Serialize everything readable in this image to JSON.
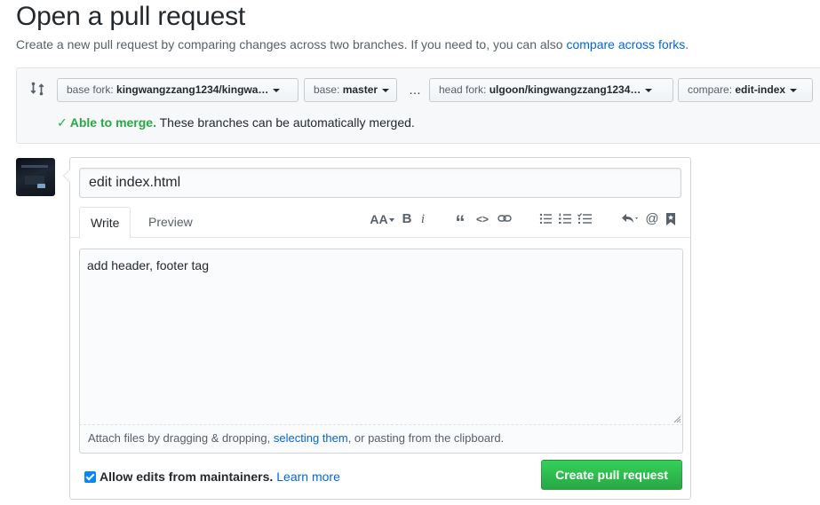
{
  "header": {
    "title": "Open a pull request",
    "subtitle": "Create a new pull request by comparing changes across two branches. If you need to, you can also ",
    "subtitle_link": "compare across forks",
    "subtitle_end": "."
  },
  "compare": {
    "base_fork_label": "base fork:",
    "base_fork_value": "kingwangzzang1234/kingwa…",
    "base_label": "base:",
    "base_value": "master",
    "dots": "…",
    "head_fork_label": "head fork:",
    "head_fork_value": "ulgoon/kingwangzzang1234…",
    "compare_label": "compare:",
    "compare_value": "edit-index",
    "merge_check": "✓",
    "merge_status": "Able to merge.",
    "merge_message": " These branches can be automatically merged."
  },
  "form": {
    "title_value": "edit index.html",
    "tabs": [
      {
        "label": "Write",
        "active": true
      },
      {
        "label": "Preview",
        "active": false
      }
    ],
    "toolbar": {
      "header_glyph": "AA",
      "bold_glyph": "B",
      "italic_glyph": "i",
      "quote_glyph": "“",
      "code_glyph": "<>",
      "mention_glyph": "@",
      "icons": [
        "text-size-icon",
        "bold-icon",
        "italic-icon",
        "quote-icon",
        "code-icon",
        "link-icon",
        "unordered-list-icon",
        "ordered-list-icon",
        "task-list-icon",
        "reply-icon",
        "mention-icon",
        "bookmark-icon"
      ]
    },
    "body_value": "add header, footer tag",
    "attach_prefix": "Attach files by dragging & dropping, ",
    "attach_link": "selecting them",
    "attach_suffix": ", or pasting from the clipboard.",
    "allow_edits_label": "Allow edits from maintainers.",
    "allow_edits_checked": true,
    "learn_more": "Learn more",
    "submit_label": "Create pull request"
  },
  "colors": {
    "link": "#0366d6",
    "success": "#28a745",
    "checkbox": "#0a84ff"
  }
}
